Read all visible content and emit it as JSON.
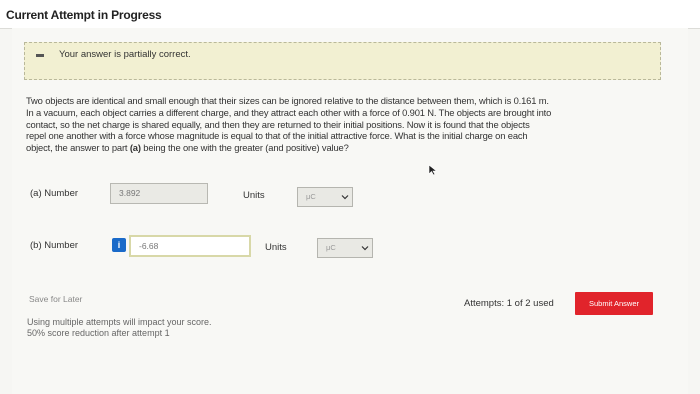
{
  "header": {
    "title": "Current Attempt in Progress"
  },
  "notice": {
    "text": "Your answer is partially correct."
  },
  "question": {
    "line1": "Two objects are identical and small enough that their sizes can be ignored relative to the distance between them, which is 0.161 m.",
    "line2": "In a vacuum, each object carries a different charge, and they attract each other with a force of 0.901 N. The objects are brought into",
    "line3": "contact, so the net charge is shared equally, and then they are returned to their initial positions. Now it is found that the objects",
    "line4": "repel one another with a force whose magnitude is equal to that of the initial attractive force. What is the initial charge on each",
    "line5_pre": "object, the answer to part ",
    "line5_bold": "(a)",
    "line5_post": " being the one with the greater (and positive) value?"
  },
  "part_a": {
    "label": "(a)  Number",
    "value": "3.892",
    "units_label": "Units",
    "units_value": "μC"
  },
  "part_b": {
    "label": "(b)  Number",
    "info_glyph": "i",
    "value": "-6.68",
    "units_label": "Units",
    "units_value": "μC"
  },
  "footer": {
    "save_later": "Save for Later",
    "note_line1": "Using multiple attempts will impact your score.",
    "note_line2": "50% score reduction after attempt 1",
    "attempts": "Attempts: 1 of 2 used",
    "submit_label": "Submit Answer"
  },
  "colors": {
    "notice_bg": "#f2f0d2",
    "submit_bg": "#e1242b",
    "info_badge": "#1a6ac9"
  },
  "icons": {
    "notice": "minus-icon",
    "info": "info-icon",
    "dropdown": "chevron-down-icon",
    "cursor": "mouse-cursor-icon"
  }
}
